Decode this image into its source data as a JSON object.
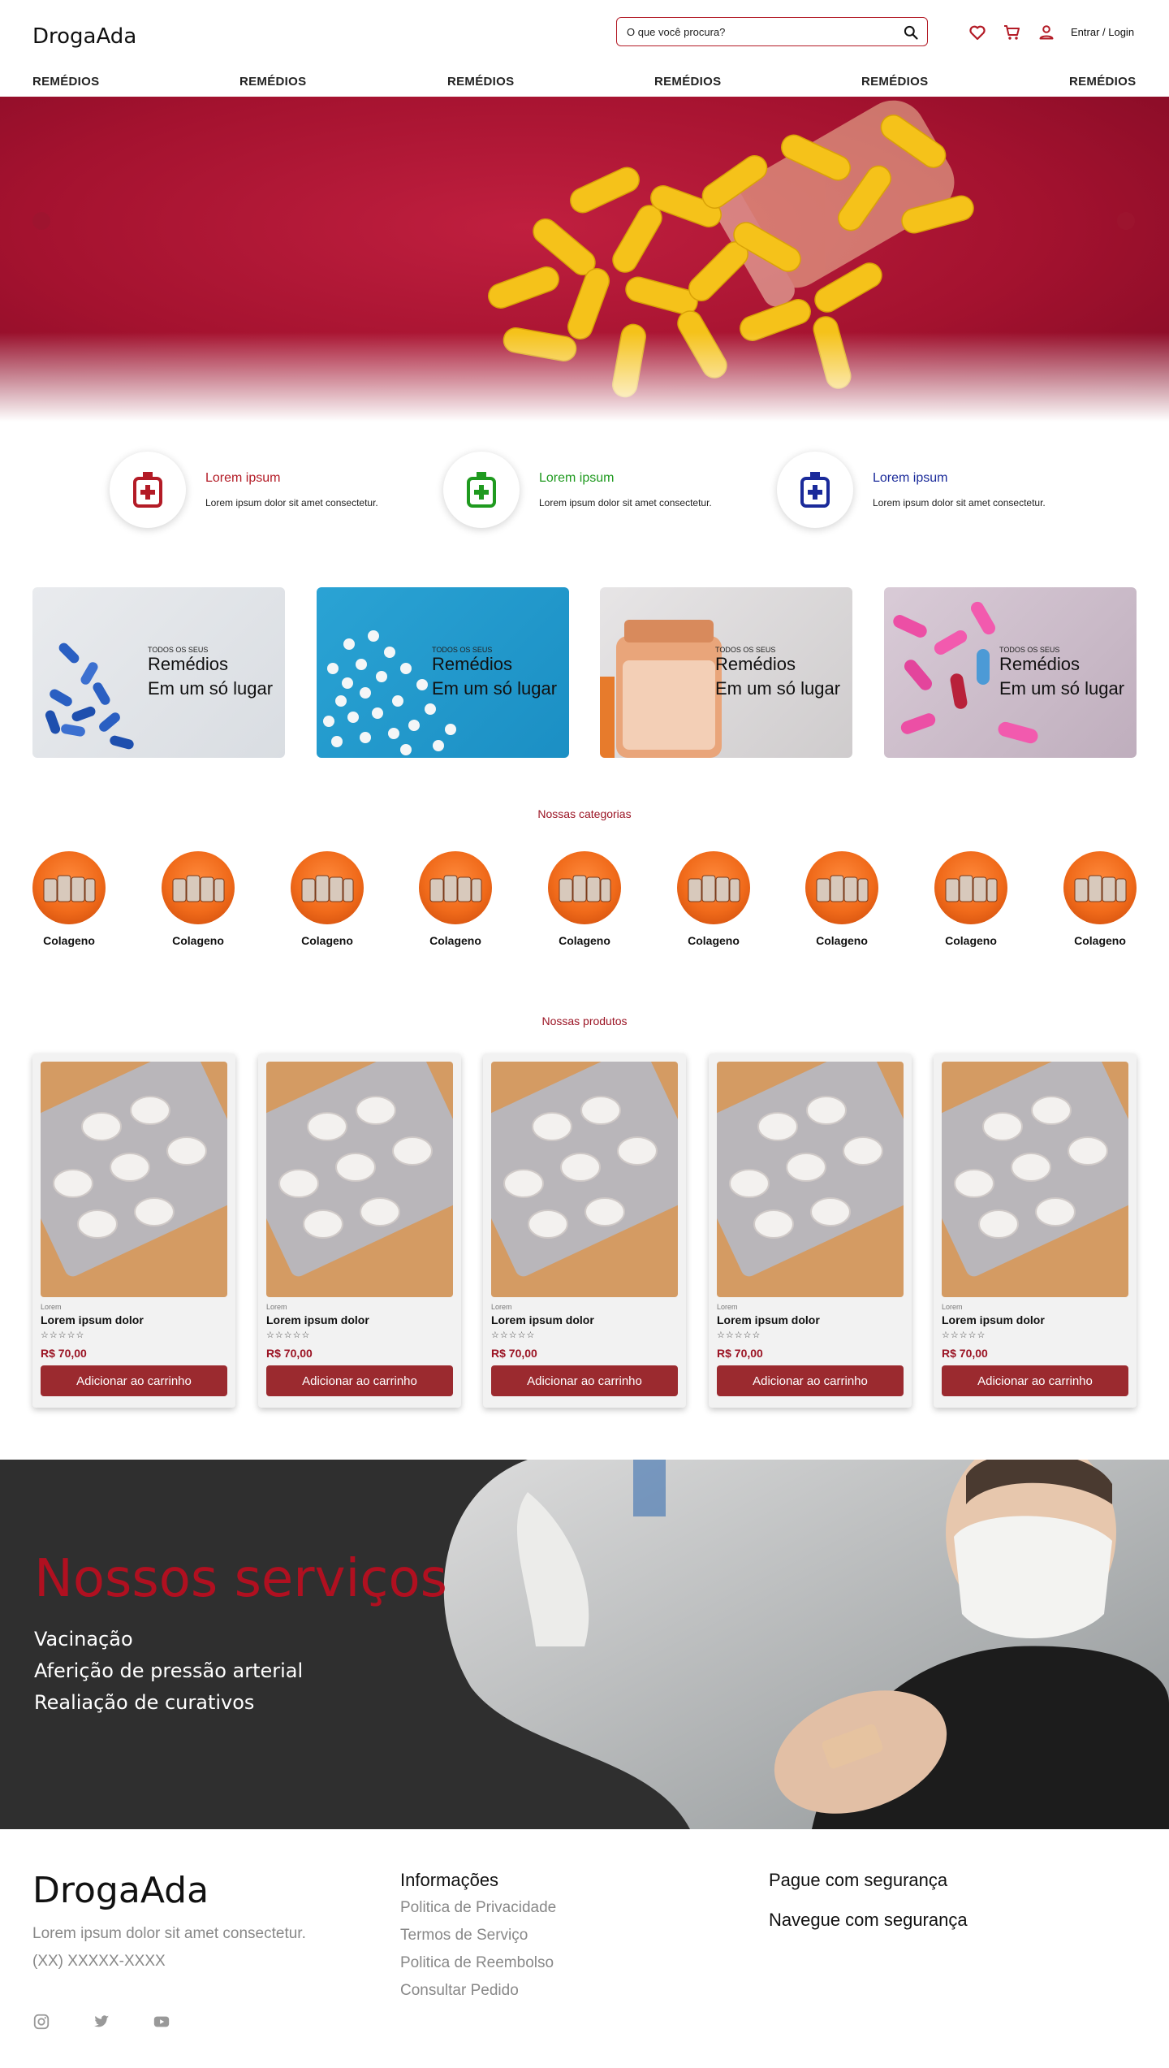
{
  "header": {
    "logo": "DrogaAda",
    "search_placeholder": "O que você procura?",
    "login_label": "Entrar / Login",
    "icons": [
      "search-icon",
      "heart-icon",
      "cart-icon",
      "user-icon"
    ]
  },
  "nav": {
    "items": [
      "REMÉDIOS",
      "REMÉDIOS",
      "REMÉDIOS",
      "REMÉDIOS",
      "REMÉDIOS",
      "REMÉDIOS"
    ]
  },
  "features": [
    {
      "title": "Lorem ipsum",
      "text": "Lorem ipsum dolor sit amet consectetur.",
      "color": "#b31b26"
    },
    {
      "title": "Lorem ipsum",
      "text": "Lorem ipsum dolor sit amet consectetur.",
      "color": "#1f9a1f"
    },
    {
      "title": "Lorem ipsum",
      "text": "Lorem ipsum dolor sit amet consectetur.",
      "color": "#1a2a9a"
    }
  ],
  "banners": [
    {
      "small": "TODOS OS SEUS",
      "line1": "Remédios",
      "line2": "Em um só lugar"
    },
    {
      "small": "TODOS OS SEUS",
      "line1": "Remédios",
      "line2": "Em um só lugar"
    },
    {
      "small": "TODOS OS SEUS",
      "line1": "Remédios",
      "line2": "Em um só lugar"
    },
    {
      "small": "TODOS OS SEUS",
      "line1": "Remédios",
      "line2": "Em um só lugar"
    }
  ],
  "categories": {
    "title": "Nossas categorias",
    "items": [
      "Colageno",
      "Colageno",
      "Colageno",
      "Colageno",
      "Colageno",
      "Colageno",
      "Colageno",
      "Colageno",
      "Colageno"
    ]
  },
  "products": {
    "title": "Nossas produtos",
    "items": [
      {
        "category": "Lorem",
        "name": "Lorem ipsum dolor",
        "stars": "☆☆☆☆☆",
        "price": "R$ 70,00",
        "button": "Adicionar ao carrinho"
      },
      {
        "category": "Lorem",
        "name": "Lorem ipsum dolor",
        "stars": "☆☆☆☆☆",
        "price": "R$ 70,00",
        "button": "Adicionar ao carrinho"
      },
      {
        "category": "Lorem",
        "name": "Lorem ipsum dolor",
        "stars": "☆☆☆☆☆",
        "price": "R$ 70,00",
        "button": "Adicionar ao carrinho"
      },
      {
        "category": "Lorem",
        "name": "Lorem ipsum dolor",
        "stars": "☆☆☆☆☆",
        "price": "R$ 70,00",
        "button": "Adicionar ao carrinho"
      },
      {
        "category": "Lorem",
        "name": "Lorem ipsum dolor",
        "stars": "☆☆☆☆☆",
        "price": "R$ 70,00",
        "button": "Adicionar ao carrinho"
      }
    ]
  },
  "services": {
    "title": "Nossos serviços",
    "items": [
      "Vacinação",
      "Aferição de pressão arterial",
      "Realiação de curativos"
    ]
  },
  "footer": {
    "logo": "DrogaAda",
    "tagline": "Lorem ipsum dolor sit amet consectetur.",
    "phone": "(XX) XXXXX-XXXX",
    "info_title": "Informações",
    "links": [
      "Politica de Privacidade",
      "Termos de Serviço",
      "Politica de Reembolso",
      "Consultar Pedido"
    ],
    "secure_pay": "Pague com segurança",
    "secure_browse": "Navegue com segurança",
    "social_icons": [
      "instagram-icon",
      "twitter-icon",
      "youtube-icon"
    ]
  },
  "colors": {
    "brand_red": "#b31b26",
    "button_red": "#9b2a2f",
    "price_red": "#9b1424",
    "services_bg": "#2f2f2f"
  }
}
